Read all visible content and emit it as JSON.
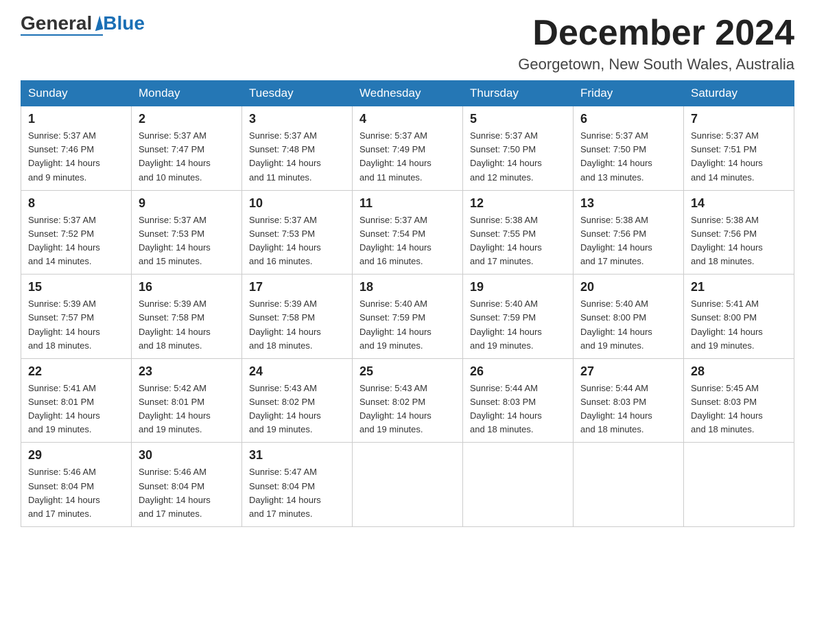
{
  "logo": {
    "text_general": "General",
    "text_blue": "Blue"
  },
  "title": {
    "month": "December 2024",
    "location": "Georgetown, New South Wales, Australia"
  },
  "weekdays": [
    "Sunday",
    "Monday",
    "Tuesday",
    "Wednesday",
    "Thursday",
    "Friday",
    "Saturday"
  ],
  "weeks": [
    [
      {
        "num": "1",
        "sunrise": "5:37 AM",
        "sunset": "7:46 PM",
        "daylight": "14 hours and 9 minutes."
      },
      {
        "num": "2",
        "sunrise": "5:37 AM",
        "sunset": "7:47 PM",
        "daylight": "14 hours and 10 minutes."
      },
      {
        "num": "3",
        "sunrise": "5:37 AM",
        "sunset": "7:48 PM",
        "daylight": "14 hours and 11 minutes."
      },
      {
        "num": "4",
        "sunrise": "5:37 AM",
        "sunset": "7:49 PM",
        "daylight": "14 hours and 11 minutes."
      },
      {
        "num": "5",
        "sunrise": "5:37 AM",
        "sunset": "7:50 PM",
        "daylight": "14 hours and 12 minutes."
      },
      {
        "num": "6",
        "sunrise": "5:37 AM",
        "sunset": "7:50 PM",
        "daylight": "14 hours and 13 minutes."
      },
      {
        "num": "7",
        "sunrise": "5:37 AM",
        "sunset": "7:51 PM",
        "daylight": "14 hours and 14 minutes."
      }
    ],
    [
      {
        "num": "8",
        "sunrise": "5:37 AM",
        "sunset": "7:52 PM",
        "daylight": "14 hours and 14 minutes."
      },
      {
        "num": "9",
        "sunrise": "5:37 AM",
        "sunset": "7:53 PM",
        "daylight": "14 hours and 15 minutes."
      },
      {
        "num": "10",
        "sunrise": "5:37 AM",
        "sunset": "7:53 PM",
        "daylight": "14 hours and 16 minutes."
      },
      {
        "num": "11",
        "sunrise": "5:37 AM",
        "sunset": "7:54 PM",
        "daylight": "14 hours and 16 minutes."
      },
      {
        "num": "12",
        "sunrise": "5:38 AM",
        "sunset": "7:55 PM",
        "daylight": "14 hours and 17 minutes."
      },
      {
        "num": "13",
        "sunrise": "5:38 AM",
        "sunset": "7:56 PM",
        "daylight": "14 hours and 17 minutes."
      },
      {
        "num": "14",
        "sunrise": "5:38 AM",
        "sunset": "7:56 PM",
        "daylight": "14 hours and 18 minutes."
      }
    ],
    [
      {
        "num": "15",
        "sunrise": "5:39 AM",
        "sunset": "7:57 PM",
        "daylight": "14 hours and 18 minutes."
      },
      {
        "num": "16",
        "sunrise": "5:39 AM",
        "sunset": "7:58 PM",
        "daylight": "14 hours and 18 minutes."
      },
      {
        "num": "17",
        "sunrise": "5:39 AM",
        "sunset": "7:58 PM",
        "daylight": "14 hours and 18 minutes."
      },
      {
        "num": "18",
        "sunrise": "5:40 AM",
        "sunset": "7:59 PM",
        "daylight": "14 hours and 19 minutes."
      },
      {
        "num": "19",
        "sunrise": "5:40 AM",
        "sunset": "7:59 PM",
        "daylight": "14 hours and 19 minutes."
      },
      {
        "num": "20",
        "sunrise": "5:40 AM",
        "sunset": "8:00 PM",
        "daylight": "14 hours and 19 minutes."
      },
      {
        "num": "21",
        "sunrise": "5:41 AM",
        "sunset": "8:00 PM",
        "daylight": "14 hours and 19 minutes."
      }
    ],
    [
      {
        "num": "22",
        "sunrise": "5:41 AM",
        "sunset": "8:01 PM",
        "daylight": "14 hours and 19 minutes."
      },
      {
        "num": "23",
        "sunrise": "5:42 AM",
        "sunset": "8:01 PM",
        "daylight": "14 hours and 19 minutes."
      },
      {
        "num": "24",
        "sunrise": "5:43 AM",
        "sunset": "8:02 PM",
        "daylight": "14 hours and 19 minutes."
      },
      {
        "num": "25",
        "sunrise": "5:43 AM",
        "sunset": "8:02 PM",
        "daylight": "14 hours and 19 minutes."
      },
      {
        "num": "26",
        "sunrise": "5:44 AM",
        "sunset": "8:03 PM",
        "daylight": "14 hours and 18 minutes."
      },
      {
        "num": "27",
        "sunrise": "5:44 AM",
        "sunset": "8:03 PM",
        "daylight": "14 hours and 18 minutes."
      },
      {
        "num": "28",
        "sunrise": "5:45 AM",
        "sunset": "8:03 PM",
        "daylight": "14 hours and 18 minutes."
      }
    ],
    [
      {
        "num": "29",
        "sunrise": "5:46 AM",
        "sunset": "8:04 PM",
        "daylight": "14 hours and 17 minutes."
      },
      {
        "num": "30",
        "sunrise": "5:46 AM",
        "sunset": "8:04 PM",
        "daylight": "14 hours and 17 minutes."
      },
      {
        "num": "31",
        "sunrise": "5:47 AM",
        "sunset": "8:04 PM",
        "daylight": "14 hours and 17 minutes."
      },
      null,
      null,
      null,
      null
    ]
  ],
  "labels": {
    "sunrise": "Sunrise:",
    "sunset": "Sunset:",
    "daylight": "Daylight:"
  }
}
